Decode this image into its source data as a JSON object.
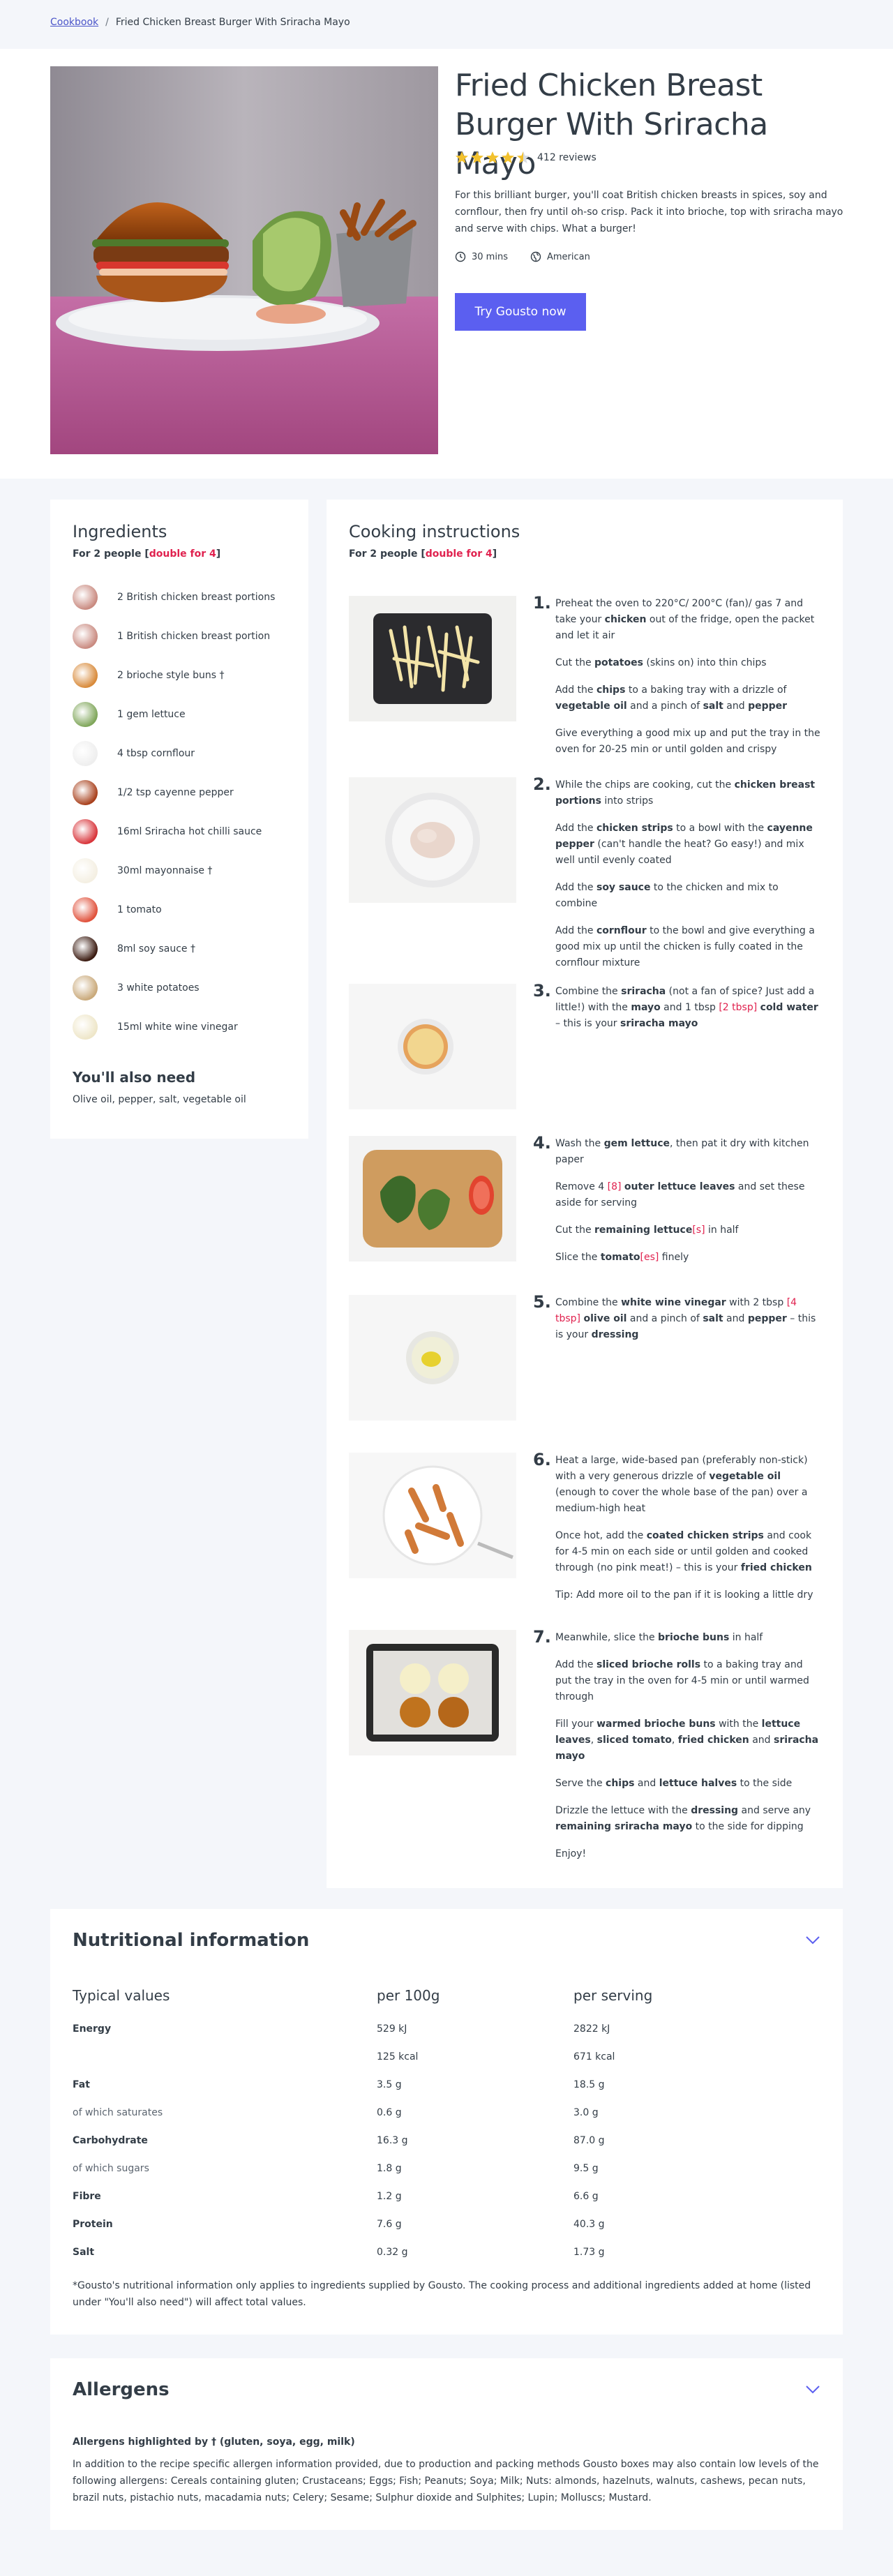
{
  "breadcrumb": {
    "home": "Cookbook",
    "separator": "/",
    "current": "Fried Chicken Breast Burger With Sriracha Mayo"
  },
  "hero": {
    "title": "Fried Chicken Breast Burger With Sriracha Mayo",
    "rating_value": 4.5,
    "reviews": "412 reviews",
    "description": "For this brilliant burger, you'll coat British chicken breasts in spices, soy and cornflour, then fry until oh-so crisp. Pack it into brioche, top with sriracha mayo and serve with chips. What a burger!",
    "time": "30 mins",
    "cuisine": "American",
    "cta": "Try Gousto now",
    "icons": {
      "time": "clock-icon",
      "cuisine": "globe-icon",
      "star": "star-icon"
    }
  },
  "colors": {
    "accent": "#5b5ff0",
    "highlight": "#e0224f",
    "star": "#f2c12e",
    "text": "#333d47"
  },
  "ingredients": {
    "title": "Ingredients",
    "serves_prefix": "For 2 people [",
    "serves_link": "double for 4",
    "serves_suffix": "]",
    "items": [
      {
        "label": "2 British chicken breast portions",
        "color": "#c98a80"
      },
      {
        "label": "1 British chicken breast portion",
        "color": "#c98a80"
      },
      {
        "label": "2 brioche style buns †",
        "color": "#d88a3a"
      },
      {
        "label": "1 gem lettuce",
        "color": "#7fa65a"
      },
      {
        "label": "4 tbsp cornflour",
        "color": "#eeeeee"
      },
      {
        "label": "1/2 tsp cayenne pepper",
        "color": "#a8401c"
      },
      {
        "label": "16ml Sriracha hot chilli sauce",
        "color": "#d8343a"
      },
      {
        "label": "30ml mayonnaise †",
        "color": "#f4efe2"
      },
      {
        "label": "1 tomato",
        "color": "#e0503a"
      },
      {
        "label": "8ml soy sauce †",
        "color": "#3a1a10"
      },
      {
        "label": "3 white potatoes",
        "color": "#c9a97a"
      },
      {
        "label": "15ml white wine vinegar",
        "color": "#eee6c8"
      }
    ],
    "also_title": "You'll also need",
    "also_text": "Olive oil, pepper, salt, vegetable oil"
  },
  "instructions": {
    "title": "Cooking instructions",
    "serves_prefix": "For 2 people [",
    "serves_link": "double for 4",
    "serves_suffix": "]",
    "steps": [
      {
        "num": "1.",
        "image": "chips-on-tray",
        "paragraphs": [
          [
            [
              "Preheat the oven to 220°C/ 200°C (fan)/ gas 7 and take your ",
              ""
            ],
            [
              "chicken",
              "b"
            ],
            [
              " out of the fridge, open the packet and let it air",
              ""
            ]
          ],
          [
            [
              "Cut the ",
              ""
            ],
            [
              "potatoes",
              "b"
            ],
            [
              " (skins on) into thin chips",
              ""
            ]
          ],
          [
            [
              "Add the ",
              ""
            ],
            [
              "chips",
              "b"
            ],
            [
              " to a baking tray with a drizzle of ",
              ""
            ],
            [
              "vegetable oil",
              "b"
            ],
            [
              " and a pinch of ",
              ""
            ],
            [
              "salt",
              "b"
            ],
            [
              " and ",
              ""
            ],
            [
              "pepper",
              "b"
            ]
          ],
          [
            [
              "Give everything a good mix up and put the tray in the oven for 20-25 min or until golden and crispy",
              ""
            ]
          ]
        ]
      },
      {
        "num": "2.",
        "image": "chicken-strips-bowl",
        "paragraphs": [
          [
            [
              "While the chips are cooking, cut the ",
              ""
            ],
            [
              "chicken breast portions",
              "b"
            ],
            [
              " into strips",
              ""
            ]
          ],
          [
            [
              "Add the ",
              ""
            ],
            [
              "chicken strips",
              "b"
            ],
            [
              " to a bowl with the ",
              ""
            ],
            [
              "cayenne pepper",
              "b"
            ],
            [
              " (can't handle the heat? Go easy!) and mix well until evenly coated",
              ""
            ]
          ],
          [
            [
              "Add the ",
              ""
            ],
            [
              "soy sauce",
              "b"
            ],
            [
              " to the chicken and mix to combine",
              ""
            ]
          ],
          [
            [
              "Add the ",
              ""
            ],
            [
              "cornflour",
              "b"
            ],
            [
              " to the bowl and give everything a good mix up until the chicken is fully coated in the cornflour mixture",
              ""
            ]
          ]
        ]
      },
      {
        "num": "3.",
        "image": "sriracha-mayo-bowl",
        "paragraphs": [
          [
            [
              "Combine the ",
              ""
            ],
            [
              "sriracha",
              "b"
            ],
            [
              " (not a fan of spice? Just add a little!) with the ",
              ""
            ],
            [
              "mayo",
              "b"
            ],
            [
              " and 1 tbsp ",
              ""
            ],
            [
              "[2 tbsp]",
              "h"
            ],
            [
              " ",
              ""
            ],
            [
              "cold water",
              "b"
            ],
            [
              " – this is your ",
              ""
            ],
            [
              "sriracha mayo",
              "b"
            ]
          ]
        ]
      },
      {
        "num": "4.",
        "image": "lettuce-tomato-board",
        "paragraphs": [
          [
            [
              "Wash the ",
              ""
            ],
            [
              "gem lettuce",
              "b"
            ],
            [
              ", then pat it dry with kitchen paper",
              ""
            ]
          ],
          [
            [
              "Remove 4 ",
              ""
            ],
            [
              "[8]",
              "h"
            ],
            [
              " ",
              ""
            ],
            [
              "outer lettuce leaves",
              "b"
            ],
            [
              " and set these aside for serving",
              ""
            ]
          ],
          [
            [
              "Cut the ",
              ""
            ],
            [
              "remaining lettuce",
              "b"
            ],
            [
              "[s]",
              "h"
            ],
            [
              " in half",
              ""
            ]
          ],
          [
            [
              "Slice the ",
              ""
            ],
            [
              "tomato",
              "b"
            ],
            [
              "[es]",
              "h"
            ],
            [
              " finely",
              ""
            ]
          ]
        ]
      },
      {
        "num": "5.",
        "image": "dressing-bowl",
        "paragraphs": [
          [
            [
              "Combine the ",
              ""
            ],
            [
              "white wine vinegar",
              "b"
            ],
            [
              " with 2 tbsp ",
              ""
            ],
            [
              "[4 tbsp]",
              "h"
            ],
            [
              " ",
              ""
            ],
            [
              "olive oil",
              "b"
            ],
            [
              " and a pinch of ",
              ""
            ],
            [
              "salt",
              "b"
            ],
            [
              " and ",
              ""
            ],
            [
              "pepper",
              "b"
            ],
            [
              " – this is your ",
              ""
            ],
            [
              "dressing",
              "b"
            ]
          ]
        ]
      },
      {
        "num": "6.",
        "image": "fried-chicken-plate",
        "paragraphs": [
          [
            [
              "Heat a large, wide-based pan (preferably non-stick) with a very generous drizzle of ",
              ""
            ],
            [
              "vegetable oil",
              "b"
            ],
            [
              " (enough to cover the whole base of the pan) over a medium-high heat",
              ""
            ]
          ],
          [
            [
              "Once hot, add the ",
              ""
            ],
            [
              "coated chicken strips",
              "b"
            ],
            [
              " and cook for 4-5 min on each side or until golden and cooked through (no pink meat!) – this is your ",
              ""
            ],
            [
              "fried chicken",
              "b"
            ]
          ],
          [
            [
              "Tip: Add more oil to the pan if it is looking a little dry",
              ""
            ]
          ]
        ]
      },
      {
        "num": "7.",
        "image": "brioche-buns-tray",
        "paragraphs": [
          [
            [
              "Meanwhile, slice the ",
              ""
            ],
            [
              "brioche buns",
              "b"
            ],
            [
              " in half",
              ""
            ]
          ],
          [
            [
              "Add the ",
              ""
            ],
            [
              "sliced brioche rolls",
              "b"
            ],
            [
              " to a baking tray and put the tray in the oven for 4-5 min or until warmed through",
              ""
            ]
          ],
          [
            [
              "Fill your ",
              ""
            ],
            [
              "warmed brioche buns",
              "b"
            ],
            [
              " with the ",
              ""
            ],
            [
              "lettuce leaves",
              "b"
            ],
            [
              ", ",
              ""
            ],
            [
              "sliced tomato",
              "b"
            ],
            [
              ", ",
              ""
            ],
            [
              "fried chicken",
              "b"
            ],
            [
              " and ",
              ""
            ],
            [
              "sriracha mayo",
              "b"
            ]
          ],
          [
            [
              "Serve the ",
              ""
            ],
            [
              "chips",
              "b"
            ],
            [
              " and ",
              ""
            ],
            [
              "lettuce halves",
              "b"
            ],
            [
              " to the side",
              ""
            ]
          ],
          [
            [
              "Drizzle the lettuce with the ",
              ""
            ],
            [
              "dressing",
              "b"
            ],
            [
              " and serve any ",
              ""
            ],
            [
              "remaining sriracha mayo",
              "b"
            ],
            [
              " to the side for dipping",
              ""
            ]
          ],
          [
            [
              "Enjoy!",
              ""
            ]
          ]
        ]
      }
    ]
  },
  "nutrition": {
    "title": "Nutritional information",
    "headers": [
      "Typical values",
      "per 100g",
      "per serving"
    ],
    "rows": [
      {
        "label": "Energy",
        "per100": "529 kJ",
        "serving": "2822 kJ",
        "style": "lbl"
      },
      {
        "label": "",
        "per100": "125 kcal",
        "serving": "671 kcal",
        "style": "lbl"
      },
      {
        "label": "Fat",
        "per100": "3.5 g",
        "serving": "18.5 g",
        "style": "lbl"
      },
      {
        "label": "of which saturates",
        "per100": "0.6 g",
        "serving": "3.0 g",
        "style": "sub"
      },
      {
        "label": "Carbohydrate",
        "per100": "16.3 g",
        "serving": "87.0 g",
        "style": "lbl"
      },
      {
        "label": "of which sugars",
        "per100": "1.8 g",
        "serving": "9.5 g",
        "style": "sub"
      },
      {
        "label": "Fibre",
        "per100": "1.2 g",
        "serving": "6.6 g",
        "style": "lbl"
      },
      {
        "label": "Protein",
        "per100": "7.6 g",
        "serving": "40.3 g",
        "style": "lbl"
      },
      {
        "label": "Salt",
        "per100": "0.32 g",
        "serving": "1.73 g",
        "style": "lbl"
      }
    ],
    "note": "*Gousto's nutritional information only applies to ingredients supplied by Gousto. The cooking process and additional ingredients added at home (listed under \"You'll also need\") will affect total values."
  },
  "allergens": {
    "title": "Allergens",
    "subtitle": "Allergens highlighted by † (gluten, soya, egg, milk)",
    "text": "In addition to the recipe specific allergen information provided, due to production and packing methods Gousto boxes may also contain low levels of the following allergens: Cereals containing gluten; Crustaceans; Eggs; Fish; Peanuts; Soya; Milk; Nuts: almonds, hazelnuts, walnuts, cashews, pecan nuts, brazil nuts, pistachio nuts, macadamia nuts; Celery; Sesame; Sulphur dioxide and Sulphites; Lupin; Molluscs; Mustard."
  }
}
